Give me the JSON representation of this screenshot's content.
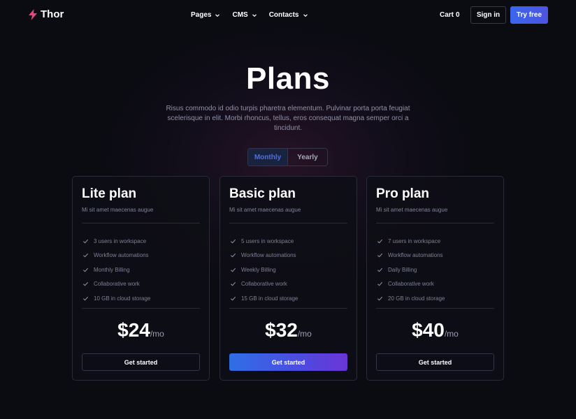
{
  "brand": {
    "name": "Thor",
    "accent": "#e8457b"
  },
  "nav": {
    "items": [
      {
        "label": "Pages"
      },
      {
        "label": "CMS"
      },
      {
        "label": "Contacts"
      }
    ],
    "cart_label": "Cart",
    "cart_count": "0",
    "signin_label": "Sign in",
    "tryfree_label": "Try free"
  },
  "hero": {
    "title": "Plans",
    "subtitle": "Risus commodo id odio turpis pharetra elementum. Pulvinar porta porta feugiat scelerisque in elit. Morbi rhoncus, tellus, eros consequat magna semper orci a tincidunt."
  },
  "billing_toggle": {
    "options": [
      "Monthly",
      "Yearly"
    ],
    "selected": "Monthly"
  },
  "plans": [
    {
      "name": "Lite plan",
      "subtitle": "Mi sit amet maecenas augue",
      "features": [
        "3 users in workspace",
        "Workflow automations",
        "Monthly Billing",
        "Collaborative work",
        "10 GB in cloud storage"
      ],
      "price": "$24",
      "period": "/mo",
      "cta": "Get started",
      "featured": false
    },
    {
      "name": "Basic plan",
      "subtitle": "Mi sit amet maecenas augue",
      "features": [
        "5 users in workspace",
        "Workflow automations",
        "Weekly Billing",
        "Collaborative work",
        "15 GB in cloud storage"
      ],
      "price": "$32",
      "period": "/mo",
      "cta": "Get started",
      "featured": true
    },
    {
      "name": "Pro plan",
      "subtitle": "Mi sit amet maecenas augue",
      "features": [
        "7 users in workspace",
        "Workflow automations",
        "Daily Billing",
        "Collaborative work",
        "20 GB in cloud storage"
      ],
      "price": "$40",
      "period": "/mo",
      "cta": "Get started",
      "featured": false
    }
  ],
  "colors": {
    "background": "#0b0b12",
    "primary_gradient_start": "#2f6fe6",
    "primary_gradient_end": "#6a35d6",
    "muted_text": "#8f92a8"
  }
}
